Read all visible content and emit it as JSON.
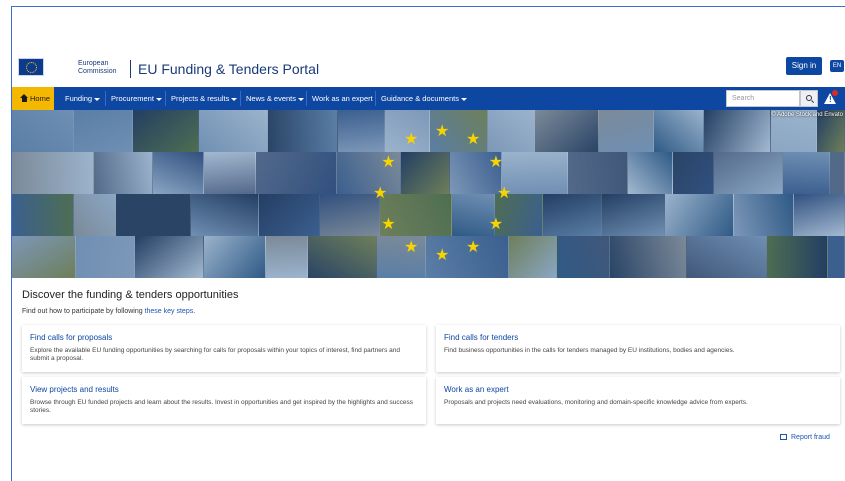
{
  "header": {
    "logo_line1": "European",
    "logo_line2": "Commission",
    "portal_title": "EU Funding & Tenders Portal",
    "signin_label": "Sign in",
    "lang_label": "EN"
  },
  "nav": {
    "items": [
      {
        "label": "Home"
      },
      {
        "label": "Funding"
      },
      {
        "label": "Procurement"
      },
      {
        "label": "Projects & results"
      },
      {
        "label": "News & events"
      },
      {
        "label": "Work as an expert"
      },
      {
        "label": "Guidance & documents"
      }
    ],
    "search_placeholder": "Search"
  },
  "hero": {
    "credit": "© Adobe Stock and Envato"
  },
  "main": {
    "title": "Discover the funding & tenders opportunities",
    "intro_text": "Find out how to participate by following ",
    "intro_link": "these key steps",
    "intro_end": ".",
    "cards": [
      {
        "title": "Find calls for proposals",
        "desc": "Explore the available EU funding opportunities by searching for calls for proposals within your topics of interest, find partners and submit a proposal."
      },
      {
        "title": "Find calls for tenders",
        "desc": "Find business opportunities in the calls for tenders managed by EU institutions, bodies and agencies."
      },
      {
        "title": "View projects and results",
        "desc": "Browse through EU funded projects and learn about the results. Invest in opportunities and get inspired by the highlights and success stories."
      },
      {
        "title": "Work as an expert",
        "desc": "Proposals and projects need evaluations, monitoring and domain-specific knowledge advice from experts."
      }
    ],
    "report_fraud": "Report fraud"
  },
  "colors": {
    "nav_bg": "#0e47a1",
    "home_bg": "#f5b800",
    "star": "#f7d300"
  }
}
